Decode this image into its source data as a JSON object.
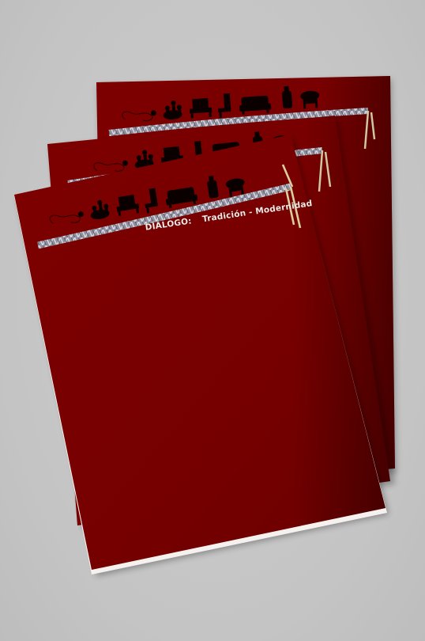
{
  "brochure": {
    "title_prefix": "DIÁLOGO:",
    "title_rest": "Tradición - Modernidad"
  },
  "colors": {
    "background": "#c6c6c6",
    "paper": "#7a0000",
    "paper_shadow": "#5e0000",
    "paper_edge": "#f4f1ef",
    "rope": "#9a9aa8",
    "silhouette": "#0b0000",
    "caption": "#f1e9e6"
  },
  "icons": [
    "necklace-icon",
    "coral-icon",
    "armchair-icon",
    "chair-icon",
    "sofa-icon",
    "bottle-icon",
    "stool-icon"
  ]
}
